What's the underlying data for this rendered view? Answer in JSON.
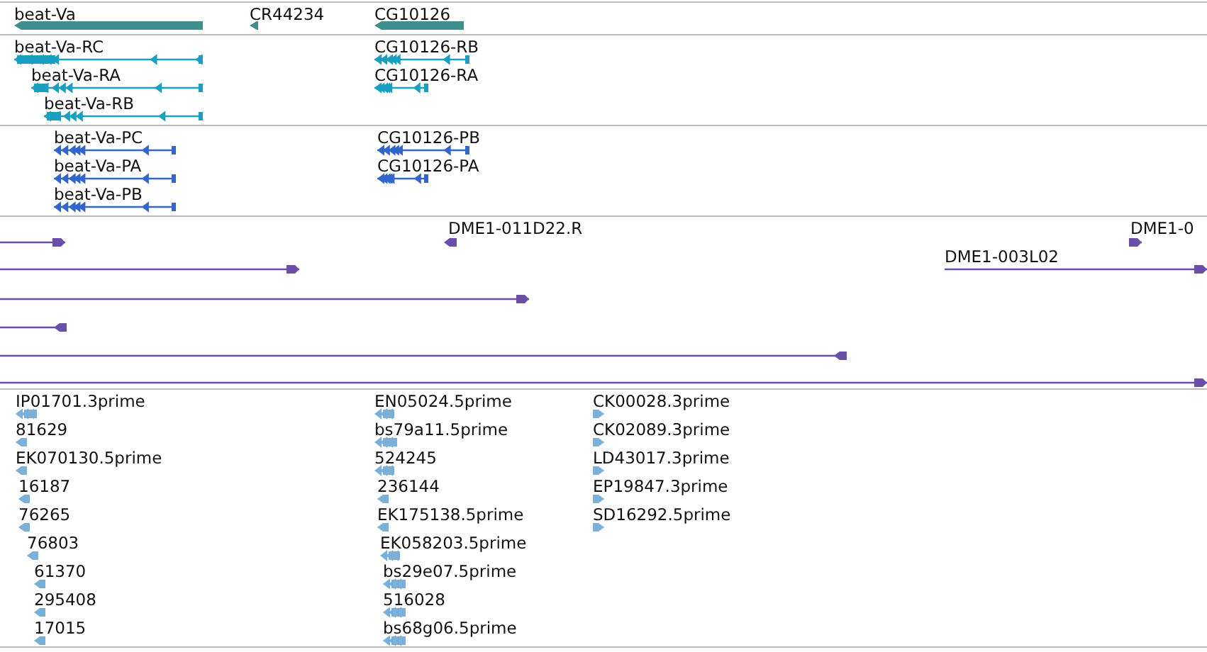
{
  "tracks": [
    {
      "kind": "gene",
      "features": [
        {
          "label": "beat-Va",
          "reverse": true
        },
        {
          "label": "CR44234",
          "reverse": true
        },
        {
          "label": "CG10126",
          "reverse": true
        }
      ]
    },
    {
      "kind": "transcript",
      "features": [
        {
          "label": "beat-Va-RC",
          "reverse": true
        },
        {
          "label": "beat-Va-RA",
          "reverse": true
        },
        {
          "label": "beat-Va-RB",
          "reverse": true
        },
        {
          "label": "CG10126-RB",
          "reverse": true
        },
        {
          "label": "CG10126-RA",
          "reverse": true
        }
      ]
    },
    {
      "kind": "protein",
      "features": [
        {
          "label": "beat-Va-PC",
          "reverse": true
        },
        {
          "label": "beat-Va-PA",
          "reverse": true
        },
        {
          "label": "beat-Va-PB",
          "reverse": true
        },
        {
          "label": "CG10126-PB",
          "reverse": true
        },
        {
          "label": "CG10126-PA",
          "reverse": true
        }
      ]
    },
    {
      "kind": "clone",
      "features": [
        {
          "label": "DME1-011D22.R",
          "reverse": true
        },
        {
          "label": "DME1-0",
          "reverse": false
        },
        {
          "label": "DME1-003L02",
          "reverse": false
        },
        {
          "reverse": false
        },
        {
          "reverse": false
        },
        {
          "reverse": false
        },
        {
          "reverse": true
        },
        {
          "reverse": true
        },
        {
          "reverse": false
        }
      ]
    },
    {
      "kind": "est",
      "features": [
        {
          "label": "IP01701.3prime",
          "reverse": true
        },
        {
          "label": "81629",
          "reverse": true
        },
        {
          "label": "EK070130.5prime",
          "reverse": true
        },
        {
          "label": "16187",
          "reverse": true
        },
        {
          "label": "76265",
          "reverse": true
        },
        {
          "label": "76803",
          "reverse": true
        },
        {
          "label": "61370",
          "reverse": true
        },
        {
          "label": "295408",
          "reverse": true
        },
        {
          "label": "17015",
          "reverse": true
        },
        {
          "label": "EN05024.5prime",
          "reverse": true
        },
        {
          "label": "bs79a11.5prime",
          "reverse": true
        },
        {
          "label": "524245",
          "reverse": true
        },
        {
          "label": "236144",
          "reverse": true
        },
        {
          "label": "EK175138.5prime",
          "reverse": true
        },
        {
          "label": "EK058203.5prime",
          "reverse": true
        },
        {
          "label": "bs29e07.5prime",
          "reverse": true
        },
        {
          "label": "516028",
          "reverse": true
        },
        {
          "label": "bs68g06.5prime",
          "reverse": true
        },
        {
          "label": "CK00028.3prime",
          "reverse": false
        },
        {
          "label": "CK02089.3prime",
          "reverse": false
        },
        {
          "label": "LD43017.3prime",
          "reverse": false
        },
        {
          "label": "EP19847.3prime",
          "reverse": false
        },
        {
          "label": "SD16292.5prime",
          "reverse": false
        }
      ]
    }
  ]
}
